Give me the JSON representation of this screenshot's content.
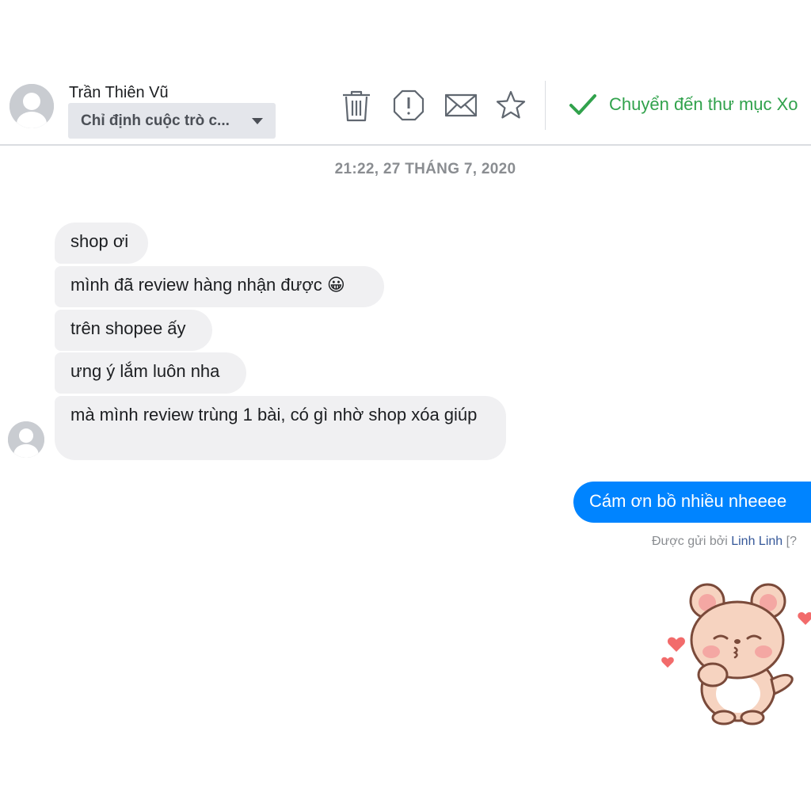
{
  "header": {
    "contact_name": "Trần Thiên Vũ",
    "assign_label": "Chỉ định cuộc trò c...",
    "tools": [
      "trash-icon",
      "report-icon",
      "mail-icon",
      "star-icon"
    ],
    "move_label": "Chuyển đến thư mục Xo"
  },
  "timestamp": "21:22, 27 THÁNG 7, 2020",
  "messages": {
    "received": [
      "shop ơi",
      "mình đã review hàng nhận được 😀",
      "trên shopee ấy",
      "ưng ý lắm luôn nha",
      "mà mình review trùng 1 bài, có gì nhờ shop xóa giúp"
    ],
    "sent": "Cám ơn bồ nhiều nheeee",
    "sent_by_prefix": "Được gửi bởi",
    "sent_by_name": "Linh Linh",
    "sent_by_suffix": "[?"
  },
  "sticker": "bear-sticker",
  "colors": {
    "sent_bubble": "#0084ff",
    "received_bubble": "#f0f0f2",
    "move_action": "#31a24c",
    "divider": "#dadde1"
  }
}
